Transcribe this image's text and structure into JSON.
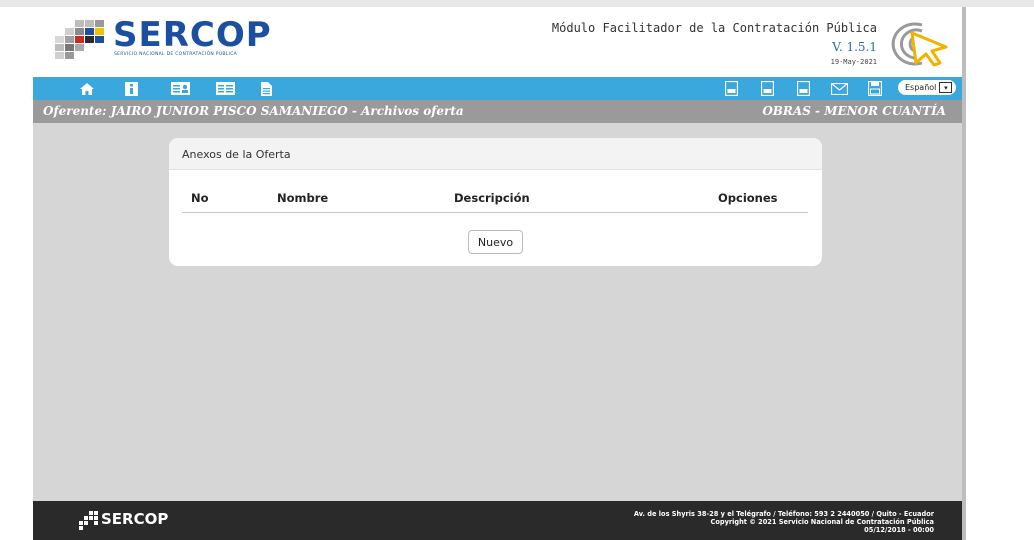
{
  "header": {
    "brand": "SERCOP",
    "brand_subtitle": "SERVICIO NACIONAL DE CONTRATACIÓN PÚBLICA",
    "module_title": "Módulo Facilitador de la Contratación Pública",
    "version": "V. 1.5.1",
    "date": "19-May-2021"
  },
  "nav": {
    "left_icons": [
      "home-icon",
      "info-icon",
      "id-card-icon",
      "list-card-icon",
      "document-icon"
    ],
    "right_icons": [
      "pdf-file-icon",
      "pdf-file-icon",
      "pdf-file-icon",
      "mail-icon",
      "save-icon"
    ],
    "language": "Español"
  },
  "context": {
    "left": "Oferente: JAIRO JUNIOR PISCO SAMANIEGO - Archivos oferta",
    "right": "OBRAS - MENOR CUANTÍA"
  },
  "panel": {
    "title": "Anexos de la Oferta",
    "columns": [
      "No",
      "Nombre",
      "Descripción",
      "Opciones"
    ],
    "rows": [],
    "new_button": "Nuevo"
  },
  "footer": {
    "brand": "SERCOP",
    "line1": "Av. de los Shyris 38-28 y el Telégrafo / Teléfono: 593 2 2440050 / Quito - Ecuador",
    "line2": "Copyright © 2021 Servicio Nacional de Contratación Pública",
    "line3": "05/12/2018 - 00:00"
  },
  "colors": {
    "nav": "#3aa7dd",
    "context_bar": "#9a9a9a",
    "content_bg": "#d6d6d6",
    "brand_blue": "#1d4fa0",
    "footer_bg": "#2a2a2a"
  }
}
